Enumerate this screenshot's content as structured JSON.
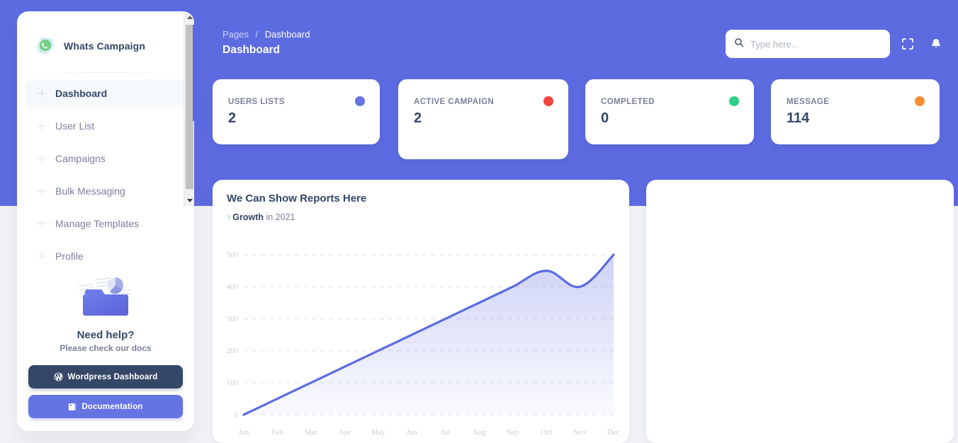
{
  "theme": {
    "brand_blue": "#5c6be0",
    "dark": "#344767",
    "muted": "#7b809a",
    "page_bg": "#f0f2f5"
  },
  "sidebar": {
    "brand": {
      "title": "Whats Campaign",
      "logo_icon": "whatsapp-icon"
    },
    "items": [
      {
        "label": "Dashboard",
        "active": true,
        "icon": "dashboard-icon"
      },
      {
        "label": "User List",
        "active": false,
        "icon": "user-list-icon"
      },
      {
        "label": "Campaigns",
        "active": false,
        "icon": "campaigns-icon"
      },
      {
        "label": "Bulk Messaging",
        "active": false,
        "icon": "bulk-messaging-icon"
      },
      {
        "label": "Manage Templates",
        "active": false,
        "icon": "manage-templates-icon"
      },
      {
        "label": "Profile",
        "active": false,
        "icon": "profile-icon"
      }
    ],
    "help": {
      "illustration": "folder-documents-icon",
      "title": "Need help?",
      "subtitle": "Please check our docs",
      "wordpress_button": {
        "label": "Wordpress Dashboard",
        "icon": "wordpress-icon"
      },
      "documentation_button": {
        "label": "Documentation",
        "icon": "book-icon"
      }
    }
  },
  "header": {
    "breadcrumb": {
      "parent": "Pages",
      "separator": "/",
      "current": "Dashboard"
    },
    "title": "Dashboard",
    "search": {
      "placeholder": "Type here...",
      "value": "",
      "icon": "search-icon"
    },
    "actions": [
      {
        "name": "fullscreen-icon",
        "label": "Fullscreen"
      },
      {
        "name": "bell-icon",
        "label": "Notifications"
      }
    ]
  },
  "stats": [
    {
      "label": "USERS LISTS",
      "value": "2",
      "dot_color": "#6574e3"
    },
    {
      "label": "ACTIVE CAMPAIGN",
      "value": "2",
      "dot_color": "#f4433c"
    },
    {
      "label": "COMPLETED",
      "value": "0",
      "dot_color": "#2dce89"
    },
    {
      "label": "MESSAGE",
      "value": "114",
      "dot_color": "#fb8c36"
    }
  ],
  "report_card": {
    "title": "We Can Show Reports Here",
    "growth_arrow": "↑",
    "growth_label": "Growth",
    "growth_suffix": "in 2021"
  },
  "chart_data": {
    "type": "area",
    "title": "We Can Show Reports Here",
    "xlabel": "",
    "ylabel": "",
    "grid": true,
    "legend": "none",
    "categories": [
      "Jan",
      "Feb",
      "Mar",
      "Apr",
      "May",
      "Jun",
      "Jul",
      "Aug",
      "Sep",
      "Oct",
      "Nov",
      "Dec"
    ],
    "tick_labels_y": [
      "500",
      "400",
      "300",
      "200",
      "100",
      "0"
    ],
    "ylim": [
      0,
      500
    ],
    "series": [
      {
        "name": "Growth",
        "color": "#5c6be0",
        "fill": "rgba(92,107,224,0.14)",
        "values": [
          0,
          50,
          100,
          150,
          200,
          250,
          300,
          350,
          400,
          450,
          400,
          500
        ]
      }
    ]
  },
  "side_card": {
    "content": ""
  }
}
